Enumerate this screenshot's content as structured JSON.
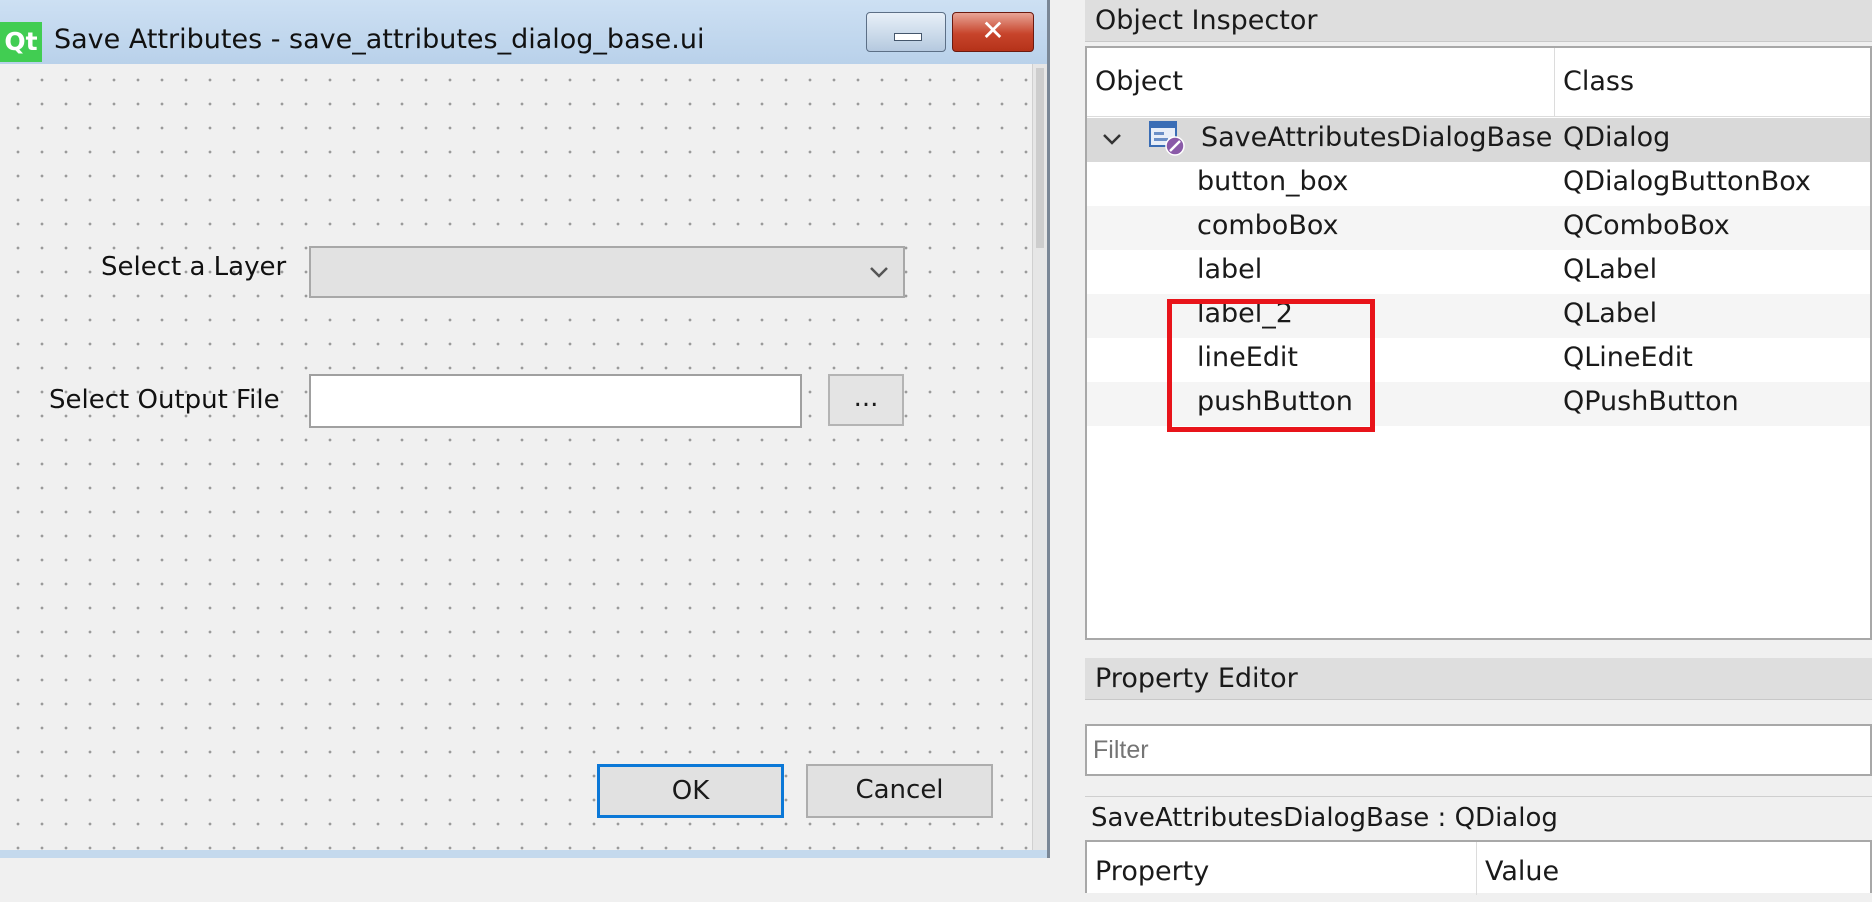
{
  "window": {
    "app_icon_text": "Qt",
    "title": "Save Attributes - save_attributes_dialog_base.ui",
    "close_glyph": "✕"
  },
  "form": {
    "layer_label": "Select a Layer",
    "layer_combo_value": "",
    "output_label": "Select Output File",
    "output_value": "",
    "browse_label": "...",
    "ok_label": "OK",
    "cancel_label": "Cancel"
  },
  "object_inspector": {
    "title": "Object Inspector",
    "columns": [
      "Object",
      "Class"
    ],
    "root": {
      "name": "SaveAttributesDialogBase",
      "class": "QDialog",
      "expanded": true
    },
    "children": [
      {
        "name": "button_box",
        "class": "QDialogButtonBox"
      },
      {
        "name": "comboBox",
        "class": "QComboBox"
      },
      {
        "name": "label",
        "class": "QLabel"
      },
      {
        "name": "label_2",
        "class": "QLabel"
      },
      {
        "name": "lineEdit",
        "class": "QLineEdit"
      },
      {
        "name": "pushButton",
        "class": "QPushButton"
      }
    ],
    "highlight_color": "#e8141a"
  },
  "property_editor": {
    "title": "Property Editor",
    "filter_placeholder": "Filter",
    "object_class": "SaveAttributesDialogBase : QDialog",
    "columns": [
      "Property",
      "Value"
    ]
  }
}
